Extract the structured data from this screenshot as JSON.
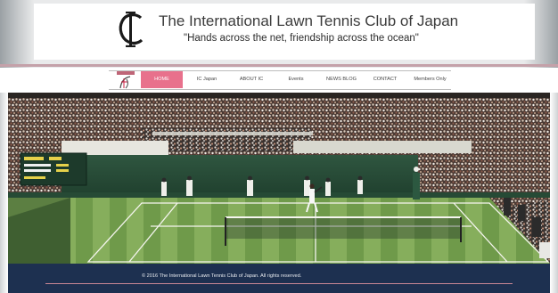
{
  "header": {
    "title": "The International Lawn Tennis Club of Japan",
    "tagline": "\"Hands across the net, friendship across the ocean\"",
    "logo_icon": "ic-monogram-icon"
  },
  "nav": {
    "logo_icon": "club-crest-icon",
    "items": [
      {
        "label": "HOME",
        "active": true
      },
      {
        "label": "IC Japan",
        "active": false
      },
      {
        "label": "ABOUT IC",
        "active": false
      },
      {
        "label": "Events",
        "active": false
      },
      {
        "label": "NEWS BLOG",
        "active": false
      },
      {
        "label": "CONTACT",
        "active": false
      },
      {
        "label": "Members Only",
        "active": false
      }
    ],
    "active_color": "#e8718c"
  },
  "hero": {
    "subject": "grass-court-stadium-photo"
  },
  "footer": {
    "copyright": "© 2016 The International Lawn Tennis Club of Japan. All rights reserved.",
    "background": "#1d3050"
  }
}
